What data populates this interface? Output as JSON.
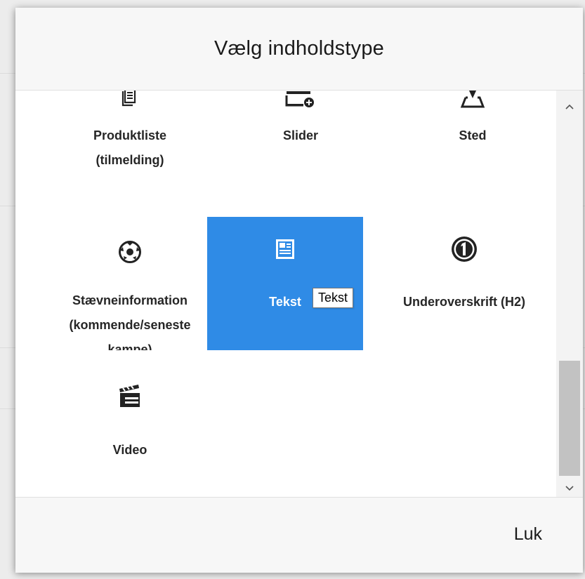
{
  "modal": {
    "title": "Vælg indholdstype",
    "close_label": "Luk"
  },
  "tiles": [
    {
      "label_lines": [
        "Produktliste",
        "(tilmelding)"
      ],
      "icon": "list-document-icon"
    },
    {
      "label_lines": [
        "Slider",
        ""
      ],
      "icon": "slider-add-icon"
    },
    {
      "label_lines": [
        "Sted",
        ""
      ],
      "icon": "map-pin-icon"
    },
    {
      "label_lines": [
        "Stævneinformation",
        "(kommende/seneste",
        "kampe)"
      ],
      "icon": "soccer-ball-icon"
    },
    {
      "label_lines": [
        "Tekst",
        ""
      ],
      "icon": "text-document-icon",
      "selected": true
    },
    {
      "label_lines": [
        "Underoverskrift (H2)",
        ""
      ],
      "icon": "number-one-circle-icon"
    },
    {
      "label_lines": [
        "Video",
        ""
      ],
      "icon": "clapperboard-icon"
    }
  ],
  "tooltip": {
    "text": "Tekst"
  },
  "scrollbar": {
    "up": "⌃",
    "down": "⌄"
  },
  "colors": {
    "selected_tile": "#2f8be6",
    "header_bg": "#f7f7f7"
  }
}
